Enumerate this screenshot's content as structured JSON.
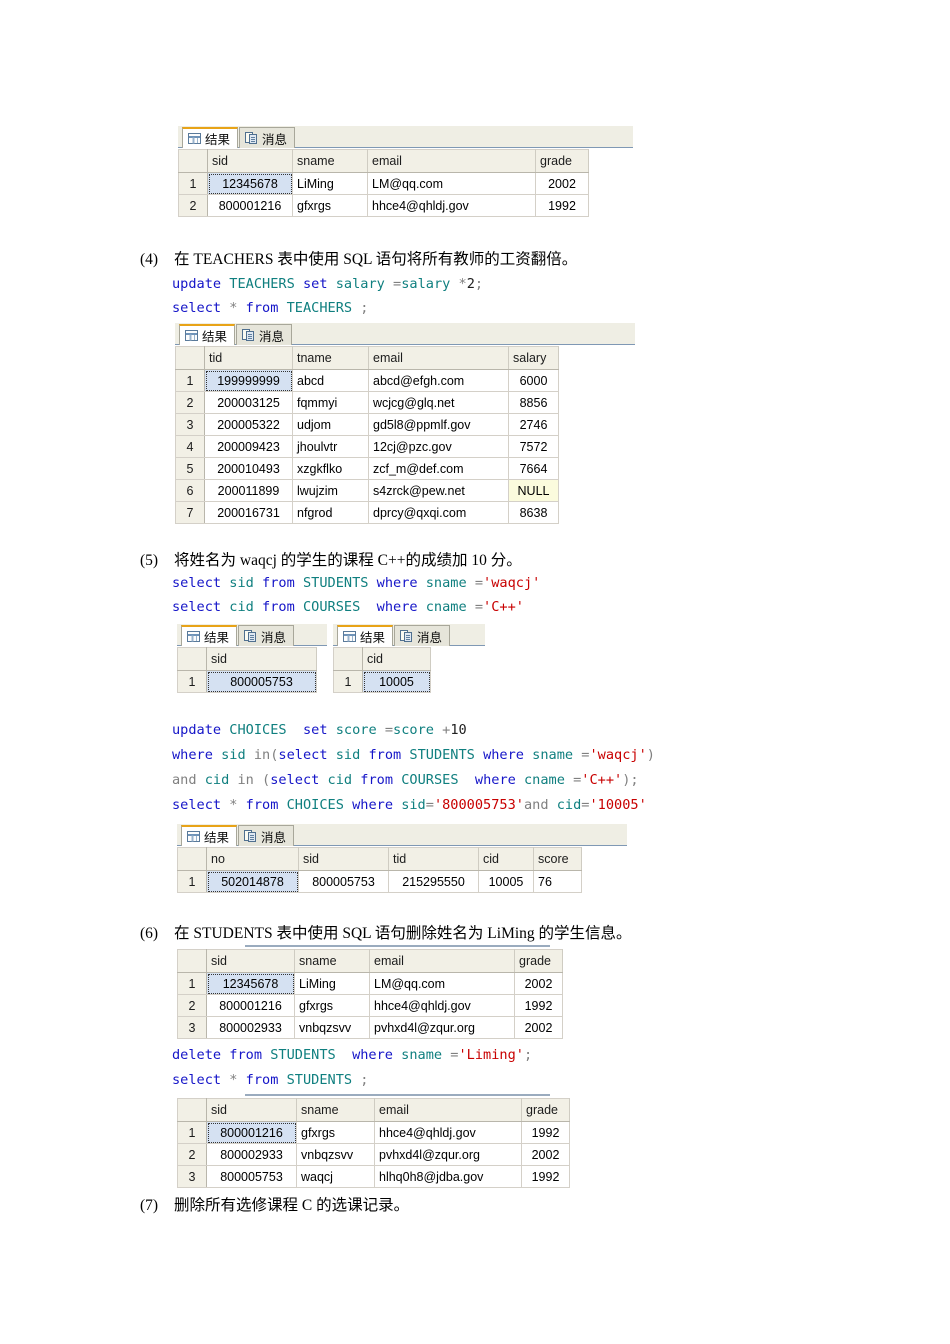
{
  "document": {
    "tabs": {
      "results_label": "结果",
      "messages_label": "消息"
    }
  },
  "sections": [
    {
      "id": "s3_result",
      "grid": {
        "columns": [
          "",
          "sid",
          "sname",
          "email",
          "grade"
        ],
        "rows": [
          {
            "n": "1",
            "sid": "12345678",
            "sname": "LiMing",
            "email": "LM@qq.com",
            "grade": "2002"
          },
          {
            "n": "2",
            "sid": "800001216",
            "sname": "gfxrgs",
            "email": "hhce4@qhldj.gov",
            "grade": "1992"
          }
        ]
      }
    },
    {
      "id": "s4",
      "number": "(4)",
      "prompt": "在 TEACHERS 表中使用 SQL 语句将所有教师的工资翻倍。",
      "sql": [
        [
          {
            "t": "update ",
            "c": "kw"
          },
          {
            "t": "TEACHERS ",
            "c": "tbl"
          },
          {
            "t": "set ",
            "c": "kw"
          },
          {
            "t": "salary ",
            "c": "tbl"
          },
          {
            "t": "=",
            "c": "plain"
          },
          {
            "t": "salary ",
            "c": "tbl"
          },
          {
            "t": "*",
            "c": "plain"
          },
          {
            "t": "2",
            "c": "num"
          },
          {
            "t": ";",
            "c": "plain"
          }
        ],
        [
          {
            "t": "select ",
            "c": "kw"
          },
          {
            "t": "* ",
            "c": "plain"
          },
          {
            "t": "from ",
            "c": "kw"
          },
          {
            "t": "TEACHERS ",
            "c": "tbl"
          },
          {
            "t": ";",
            "c": "plain"
          }
        ]
      ],
      "grid": {
        "columns": [
          "",
          "tid",
          "tname",
          "email",
          "salary"
        ],
        "rows": [
          {
            "n": "1",
            "tid": "199999999",
            "tname": "abcd",
            "email": "abcd@efgh.com",
            "salary": "6000"
          },
          {
            "n": "2",
            "tid": "200003125",
            "tname": "fqmmyi",
            "email": "wcjcg@glq.net",
            "salary": "8856"
          },
          {
            "n": "3",
            "tid": "200005322",
            "tname": "udjom",
            "email": "gd5l8@ppmlf.gov",
            "salary": "2746"
          },
          {
            "n": "4",
            "tid": "200009423",
            "tname": "jhoulvtr",
            "email": "12cj@pzc.gov",
            "salary": "7572"
          },
          {
            "n": "5",
            "tid": "200010493",
            "tname": "xzgkflko",
            "email": "zcf_m@def.com",
            "salary": "7664"
          },
          {
            "n": "6",
            "tid": "200011899",
            "tname": "lwujzim",
            "email": "s4zrck@pew.net",
            "salary": "NULL"
          },
          {
            "n": "7",
            "tid": "200016731",
            "tname": "nfgrod",
            "email": "dprcy@qxqi.com",
            "salary": "8638"
          }
        ]
      }
    },
    {
      "id": "s5",
      "number": "(5)",
      "prompt": "将姓名为 waqcj 的学生的课程 C++的成绩加 10 分。",
      "sql": [
        [
          {
            "t": "select ",
            "c": "kw"
          },
          {
            "t": "sid ",
            "c": "tbl"
          },
          {
            "t": "from ",
            "c": "kw"
          },
          {
            "t": "STUDENTS ",
            "c": "tbl"
          },
          {
            "t": "where ",
            "c": "kw"
          },
          {
            "t": "sname ",
            "c": "tbl"
          },
          {
            "t": "=",
            "c": "plain"
          },
          {
            "t": "'waqcj'",
            "c": "str"
          }
        ],
        [
          {
            "t": "select ",
            "c": "kw"
          },
          {
            "t": "cid ",
            "c": "tbl"
          },
          {
            "t": "from ",
            "c": "kw"
          },
          {
            "t": "COURSES  ",
            "c": "tbl"
          },
          {
            "t": "where ",
            "c": "kw"
          },
          {
            "t": "cname ",
            "c": "tbl"
          },
          {
            "t": "=",
            "c": "plain"
          },
          {
            "t": "'C++'",
            "c": "str"
          }
        ]
      ],
      "grid_left": {
        "columns": [
          "",
          "sid"
        ],
        "rows": [
          {
            "n": "1",
            "sid": "800005753"
          }
        ]
      },
      "grid_right": {
        "columns": [
          "",
          "cid"
        ],
        "rows": [
          {
            "n": "1",
            "cid": "10005"
          }
        ]
      },
      "sql2": [
        [
          {
            "t": "update ",
            "c": "kw"
          },
          {
            "t": "CHOICES  ",
            "c": "tbl"
          },
          {
            "t": "set ",
            "c": "kw"
          },
          {
            "t": "score ",
            "c": "tbl"
          },
          {
            "t": "=",
            "c": "plain"
          },
          {
            "t": "score ",
            "c": "tbl"
          },
          {
            "t": "+",
            "c": "plain"
          },
          {
            "t": "10",
            "c": "num"
          }
        ],
        [
          {
            "t": "where ",
            "c": "kw"
          },
          {
            "t": "sid ",
            "c": "tbl"
          },
          {
            "t": "in(",
            "c": "plain"
          },
          {
            "t": "select ",
            "c": "kw"
          },
          {
            "t": "sid ",
            "c": "tbl"
          },
          {
            "t": "from ",
            "c": "kw"
          },
          {
            "t": "STUDENTS ",
            "c": "tbl"
          },
          {
            "t": "where ",
            "c": "kw"
          },
          {
            "t": "sname ",
            "c": "tbl"
          },
          {
            "t": "=",
            "c": "plain"
          },
          {
            "t": "'waqcj'",
            "c": "str"
          },
          {
            "t": ")",
            "c": "plain"
          }
        ],
        [
          {
            "t": "and ",
            "c": "plain"
          },
          {
            "t": "cid ",
            "c": "tbl"
          },
          {
            "t": "in (",
            "c": "plain"
          },
          {
            "t": "select ",
            "c": "kw"
          },
          {
            "t": "cid ",
            "c": "tbl"
          },
          {
            "t": "from ",
            "c": "kw"
          },
          {
            "t": "COURSES  ",
            "c": "tbl"
          },
          {
            "t": "where ",
            "c": "kw"
          },
          {
            "t": "cname ",
            "c": "tbl"
          },
          {
            "t": "=",
            "c": "plain"
          },
          {
            "t": "'C++'",
            "c": "str"
          },
          {
            "t": ");",
            "c": "plain"
          }
        ],
        [
          {
            "t": "select ",
            "c": "kw"
          },
          {
            "t": "* ",
            "c": "plain"
          },
          {
            "t": "from ",
            "c": "kw"
          },
          {
            "t": "CHOICES ",
            "c": "tbl"
          },
          {
            "t": "where ",
            "c": "kw"
          },
          {
            "t": "sid",
            "c": "tbl"
          },
          {
            "t": "=",
            "c": "plain"
          },
          {
            "t": "'800005753'",
            "c": "str"
          },
          {
            "t": "and ",
            "c": "plain"
          },
          {
            "t": "cid",
            "c": "tbl"
          },
          {
            "t": "=",
            "c": "plain"
          },
          {
            "t": "'10005'",
            "c": "str"
          }
        ]
      ],
      "grid2": {
        "columns": [
          "",
          "no",
          "sid",
          "tid",
          "cid",
          "score"
        ],
        "rows": [
          {
            "n": "1",
            "no": "502014878",
            "sid": "800005753",
            "tid": "215295550",
            "cid": "10005",
            "score": "76"
          }
        ]
      }
    },
    {
      "id": "s6",
      "number": "(6)",
      "prompt": "在 STUDENTS 表中使用 SQL 语句删除姓名为 LiMing 的学生信息。",
      "grid_before": {
        "columns": [
          "",
          "sid",
          "sname",
          "email",
          "grade"
        ],
        "rows": [
          {
            "n": "1",
            "sid": "12345678",
            "sname": "LiMing",
            "email": "LM@qq.com",
            "grade": "2002"
          },
          {
            "n": "2",
            "sid": "800001216",
            "sname": "gfxrgs",
            "email": "hhce4@qhldj.gov",
            "grade": "1992"
          },
          {
            "n": "3",
            "sid": "800002933",
            "sname": "vnbqzsvv",
            "email": "pvhxd4l@zqur.org",
            "grade": "2002"
          }
        ]
      },
      "sql": [
        [
          {
            "t": "delete ",
            "c": "kw"
          },
          {
            "t": "from ",
            "c": "kw"
          },
          {
            "t": "STUDENTS  ",
            "c": "tbl"
          },
          {
            "t": "where ",
            "c": "kw"
          },
          {
            "t": "sname ",
            "c": "tbl"
          },
          {
            "t": "=",
            "c": "plain"
          },
          {
            "t": "'Liming'",
            "c": "str"
          },
          {
            "t": ";",
            "c": "plain"
          }
        ],
        [
          {
            "t": "select ",
            "c": "kw"
          },
          {
            "t": "* ",
            "c": "plain"
          },
          {
            "t": "from ",
            "c": "kw"
          },
          {
            "t": "STUDENTS ",
            "c": "tbl"
          },
          {
            "t": ";",
            "c": "plain"
          }
        ]
      ],
      "grid_after": {
        "columns": [
          "",
          "sid",
          "sname",
          "email",
          "grade"
        ],
        "rows": [
          {
            "n": "1",
            "sid": "800001216",
            "sname": "gfxrgs",
            "email": "hhce4@qhldj.gov",
            "grade": "1992"
          },
          {
            "n": "2",
            "sid": "800002933",
            "sname": "vnbqzsvv",
            "email": "pvhxd4l@zqur.org",
            "grade": "2002"
          },
          {
            "n": "3",
            "sid": "800005753",
            "sname": "waqcj",
            "email": "hlhq0h8@jdba.gov",
            "grade": "1992"
          }
        ]
      }
    },
    {
      "id": "s7",
      "number": "(7)",
      "prompt": "删除所有选修课程 C 的选课记录。"
    }
  ]
}
